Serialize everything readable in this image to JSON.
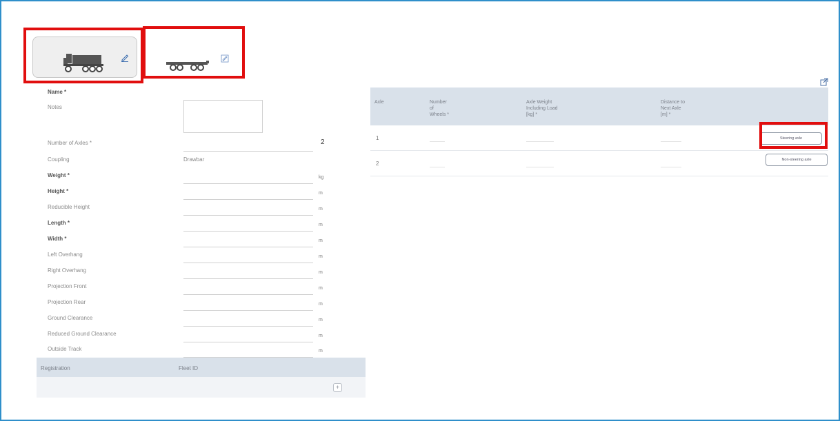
{
  "vehicle_tabs": [
    {
      "name": "truck",
      "selected": true
    },
    {
      "name": "trailer",
      "selected": false
    }
  ],
  "form": {
    "name_label": "Name *",
    "notes_label": "Notes",
    "rows": [
      {
        "label": "Number of Axles *",
        "value": "2",
        "unit": "",
        "bold": false
      },
      {
        "label": "Coupling",
        "value": "Drawbar",
        "unit": "",
        "bold": false
      },
      {
        "label": "Weight *",
        "value": "",
        "unit": "kg",
        "bold": true
      },
      {
        "label": "Height *",
        "value": "",
        "unit": "m",
        "bold": true
      },
      {
        "label": "Reducible Height",
        "value": "",
        "unit": "m",
        "bold": false
      },
      {
        "label": "Length *",
        "value": "",
        "unit": "m",
        "bold": true
      },
      {
        "label": "Width *",
        "value": "",
        "unit": "m",
        "bold": true
      },
      {
        "label": "Left Overhang",
        "value": "",
        "unit": "m",
        "bold": false
      },
      {
        "label": "Right Overhang",
        "value": "",
        "unit": "m",
        "bold": false
      },
      {
        "label": "Projection Front",
        "value": "",
        "unit": "m",
        "bold": false
      },
      {
        "label": "Projection Rear",
        "value": "",
        "unit": "m",
        "bold": false
      },
      {
        "label": "Ground Clearance",
        "value": "",
        "unit": "m",
        "bold": false
      },
      {
        "label": "Reduced Ground Clearance",
        "value": "",
        "unit": "m",
        "bold": false
      },
      {
        "label": "Outside Track",
        "value": "",
        "unit": "m",
        "bold": false
      }
    ]
  },
  "registration_table": {
    "col1": "Registration",
    "col2": "Fleet ID",
    "add_symbol": "+"
  },
  "axle_table": {
    "headers": {
      "axle": "Axle",
      "wheels": "Number\nof\nWheels *",
      "weight": "Axle Weight\nIncluding Load\n[kg] *",
      "distance": "Distance to\nNext Axle\n[m] *"
    },
    "rows": [
      {
        "axle": "1",
        "button": "Steering axle"
      },
      {
        "axle": "2",
        "button": "Non-steering axle"
      }
    ]
  },
  "colors": {
    "frame": "#2f8fca",
    "highlight": "#e10e0e",
    "table_header": "#d9e1ea"
  },
  "icons": [
    "truck-icon",
    "trailer-icon",
    "edit-icon",
    "external-link-icon",
    "plus-icon"
  ]
}
